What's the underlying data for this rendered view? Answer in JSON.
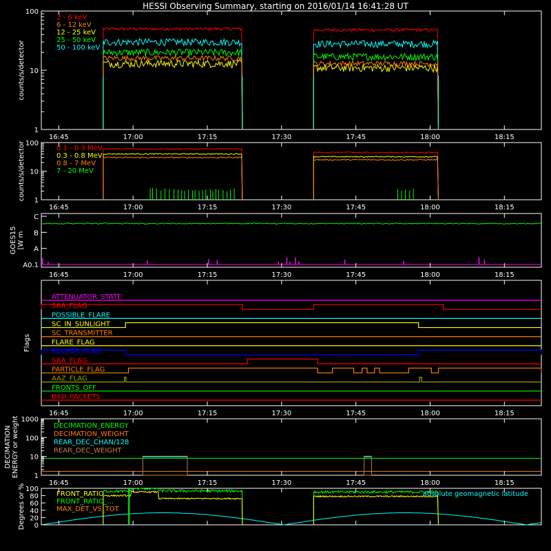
{
  "title": "HESSI Observing Summary, starting on 2016/01/14 16:41:28 UT",
  "x_axis": {
    "ticks": [
      "16:45",
      "17:00",
      "17:15",
      "17:30",
      "17:45",
      "18:00",
      "18:15"
    ],
    "tick_minutes": [
      3.53,
      18.53,
      33.53,
      48.53,
      63.53,
      78.53,
      93.53
    ],
    "range_minutes": [
      0,
      101
    ]
  },
  "colors": {
    "red": "#ff0000",
    "orange": "#ff7f00",
    "yellow": "#ffff00",
    "green": "#00ff00",
    "cyan": "#00ffff",
    "magenta": "#ff00ff",
    "blue": "#0000ff",
    "olive": "#a0a000",
    "brown": "#c08040",
    "axes": "#ffffff",
    "lime": "#00ff00"
  },
  "chart_data": [
    {
      "id": "low-energy",
      "type": "line",
      "ylabel": "counts/s/detector",
      "ylog": true,
      "ylim": [
        1,
        100
      ],
      "yticks": [
        "1",
        "10",
        "100"
      ],
      "ytick_values": [
        1,
        10,
        100
      ],
      "legend": [
        "3 - 6 keV",
        "6 - 12 keV",
        "12 - 25 keV",
        "25 - 50 keV",
        "50 - 100 keV"
      ],
      "legend_colors": [
        "#ff0000",
        "#ff7f00",
        "#ffff00",
        "#00ff00",
        "#00ffff"
      ],
      "intervals": [
        [
          12.5,
          40.6
        ],
        [
          55.0,
          80.2
        ]
      ],
      "series": [
        {
          "color": "#ff0000",
          "level": [
            50,
            48
          ],
          "noise": 0.06
        },
        {
          "color": "#00ffff",
          "level": [
            30,
            28
          ],
          "noise": 0.14
        },
        {
          "color": "#00ff00",
          "level": [
            20,
            17
          ],
          "noise": 0.14
        },
        {
          "color": "#ffff00",
          "level": [
            13,
            11
          ],
          "noise": 0.15
        },
        {
          "color": "#ff7f00",
          "level": [
            16,
            13
          ],
          "noise": 0.1
        }
      ]
    },
    {
      "id": "high-energy",
      "type": "line",
      "ylabel": "counts/s/detector",
      "ylog": true,
      "ylim": [
        1,
        100
      ],
      "yticks": [
        "1",
        "10",
        "100"
      ],
      "ytick_values": [
        1,
        10,
        100
      ],
      "legend": [
        "0.1 - 0.3 MeV",
        "0.3 - 0.8 MeV",
        "0.8 - 7 MeV",
        "7 - 20 MeV"
      ],
      "legend_colors": [
        "#ff0000",
        "#ffff00",
        "#ff7f00",
        "#00ff00"
      ],
      "intervals": [
        [
          12.5,
          40.6
        ],
        [
          55.0,
          80.2
        ]
      ],
      "series": [
        {
          "color": "#ff0000",
          "level": [
            60,
            45
          ],
          "noise": 0.05
        },
        {
          "color": "#ffff00",
          "level": [
            40,
            32
          ],
          "noise": 0.04
        },
        {
          "color": "#ff7f00",
          "level": [
            30,
            25
          ],
          "noise": 0.05
        }
      ],
      "spikes_7_20": [
        [
          22,
          39
        ],
        [
          72,
          76
        ]
      ]
    },
    {
      "id": "goes",
      "type": "line",
      "ylabel": "GOES15 [W m^-2]",
      "ylabel_line1": "GOES15",
      "ylabel_line2": "[W m",
      "yticks": [
        "A0.1",
        "A",
        "B",
        "C"
      ],
      "ytick_levels": [
        0,
        1,
        2,
        3
      ],
      "green_level": 2.55,
      "magenta_spikes": [
        0.3,
        1.4,
        21.4,
        33.8,
        35.5,
        47.9,
        49.6,
        50.2,
        51.3,
        52.0,
        61.3,
        73.2,
        88.4,
        89.5
      ]
    },
    {
      "id": "flags",
      "type": "table",
      "ylabel": "Flags",
      "flags": [
        {
          "name": "ATTENUATOR_STATE",
          "color": "#ff00ff",
          "high": []
        },
        {
          "name": "SAA_FLAG",
          "color": "#ff0000",
          "high": [
            [
              0,
              40.6
            ],
            [
              55.0,
              81.2
            ]
          ]
        },
        {
          "name": "POSSIBLE_FLARE",
          "color": "#00ffff",
          "high": []
        },
        {
          "name": "SC_IN_SUNLIGHT",
          "color": "#ffff00",
          "high": [
            [
              17.0,
              76.2
            ]
          ]
        },
        {
          "name": "SC_TRANSMITTER",
          "color": "#ff7f00",
          "high": []
        },
        {
          "name": "FLARE_FLAG",
          "color": "#ffff00",
          "high": []
        },
        {
          "name": "ECLIPSE_FLAG",
          "color": "#0000ff",
          "high": [
            [
              0,
              17.0
            ],
            [
              76.2,
              101
            ]
          ]
        },
        {
          "name": "SAA_FLAG",
          "color": "#ff0000",
          "high": [
            [
              41.6,
              55.8
            ]
          ]
        },
        {
          "name": "PARTICLE_FLAG",
          "color": "#ff7f00",
          "high": [
            [
              17.6,
              55.8
            ],
            [
              58.8,
              63.1
            ],
            [
              64.8,
              65.8
            ],
            [
              67.3,
              68.3
            ],
            [
              74.2,
              78.8
            ],
            [
              80.2,
              101
            ]
          ]
        },
        {
          "name": "AAZ_FLAG",
          "color": "#a0a000",
          "high": [
            [
              16.8,
              17.1
            ],
            [
              76.4,
              76.8
            ]
          ]
        },
        {
          "name": "FRONTS_OFF",
          "color": "#00ff00",
          "high": []
        },
        {
          "name": "BAD_PACKETS",
          "color": "#ff0000",
          "high": []
        }
      ]
    },
    {
      "id": "decimation",
      "type": "line",
      "ylabel_line1": "DECIMATION",
      "ylabel_line2": "ENERGY or weight",
      "ylog": true,
      "ylim": [
        1,
        1000
      ],
      "yticks": [
        "1",
        "10",
        "100",
        "1000"
      ],
      "ytick_values": [
        1,
        10,
        100,
        1000
      ],
      "legend": [
        "DECIMATION_ENERGY",
        "DECIMATION_WEIGHT",
        "REAR_DEC_CHAN/128",
        "REAR_DEC_WEIGHT"
      ],
      "legend_colors": [
        "#00ff00",
        "#ff7f00",
        "#00ffff",
        "#c08040"
      ],
      "energy_level": 8,
      "weight_level": 1.6,
      "boxes": [
        [
          20.5,
          29.5
        ],
        [
          65.2,
          66.7
        ]
      ]
    },
    {
      "id": "ratios",
      "type": "line",
      "ylabel": "Degrees or %",
      "ylim": [
        0,
        100
      ],
      "yticks": [
        "0",
        "20",
        "40",
        "60",
        "80",
        "100"
      ],
      "ytick_values": [
        0,
        20,
        40,
        60,
        80,
        100
      ],
      "legend": [
        "FRONT_RATIO",
        "FRONT_RATIO_...",
        "MAX_DET_VS_TOT"
      ],
      "legend_colors": [
        "#ffff00",
        "#00ff00",
        "#ff7f00"
      ],
      "note": "absolute geomagnetic latitude",
      "intervals": [
        [
          12.5,
          40.6
        ],
        [
          55.0,
          80.2
        ]
      ],
      "front_ratio_levels": [
        [
          80,
          90,
          72
        ],
        [
          78
        ]
      ],
      "front_ratio_green_levels": [
        [
          92,
          100,
          93
        ],
        [
          90
        ]
      ],
      "latitude_peaks": [
        [
          0,
          23,
          49,
          76,
          101
        ]
      ]
    }
  ]
}
